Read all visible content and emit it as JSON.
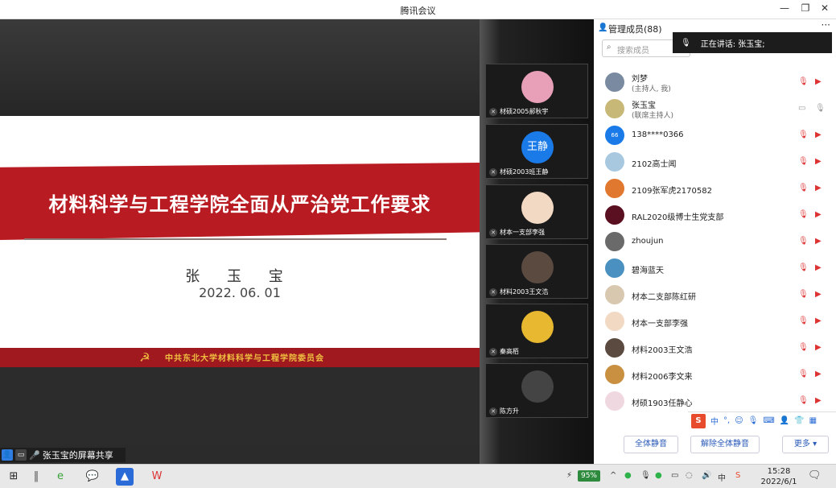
{
  "window": {
    "title": "腾讯会议",
    "minimize": "—",
    "restore": "❐",
    "close": "✕"
  },
  "slide": {
    "title": "材料科学与工程学院全面从严治党工作要求",
    "presenter": "张 玉 宝",
    "date": "2022. 06. 01",
    "footer": "中共东北大学材料科学与工程学院委员会"
  },
  "share_bar": {
    "text": "张玉宝的屏幕共享"
  },
  "thumbnails": [
    {
      "name": "材硕2005郝秋宇",
      "avatar_color": "#e8a0b8"
    },
    {
      "name": "材硕2003班王静",
      "avatar_text": "王静",
      "avatar_color": "#1a7ae8"
    },
    {
      "name": "材本一支部李强",
      "avatar_color": "#f2d9c4"
    },
    {
      "name": "材料2003王文浩",
      "avatar_color": "#5a4a40"
    },
    {
      "name": "秦高栢",
      "avatar_color": "#e8b830"
    },
    {
      "name": "陈方升",
      "avatar_color": "#444444"
    }
  ],
  "panel": {
    "header": "管理成员(88)",
    "search_placeholder": "搜索成员",
    "speaking": "正在讲话: 张玉宝;",
    "more_dots": "···",
    "members": [
      {
        "name": "刘梦",
        "role": "(主持人, 我)",
        "avatar_color": "#7a8aa0"
      },
      {
        "name": "张玉宝",
        "role": "(联席主持人)",
        "avatar_color": "#c8b878"
      },
      {
        "name": "138****0366",
        "avatar_text": "66",
        "avatar_color": "#1a7ae8"
      },
      {
        "name": "2102高士闻",
        "avatar_color": "#a8c8e0"
      },
      {
        "name": "2109张军虎2170582",
        "avatar_color": "#e07830"
      },
      {
        "name": "RAL2020级博士生党支部",
        "avatar_color": "#5a1020"
      },
      {
        "name": "zhoujun",
        "avatar_color": "#6a6a6a"
      },
      {
        "name": "碧海蓝天",
        "avatar_color": "#4a90c0"
      },
      {
        "name": "材本二支部陈红研",
        "avatar_color": "#d8c8b0"
      },
      {
        "name": "材本一支部李强",
        "avatar_color": "#f2d9c4"
      },
      {
        "name": "材料2003王文浩",
        "avatar_color": "#5a4a40"
      },
      {
        "name": "材料2006李文来",
        "avatar_color": "#c89040"
      },
      {
        "name": "材硕1903任静心",
        "avatar_color": "#f0d8e0"
      }
    ],
    "buttons": {
      "mute_all": "全体静音",
      "unmute_all": "解除全体静音",
      "more": "更多 ▾"
    }
  },
  "ime": {
    "logo": "S",
    "lang": "中"
  },
  "taskbar": {
    "battery": "95%",
    "time": "15:28",
    "date": "2022/6/1"
  }
}
